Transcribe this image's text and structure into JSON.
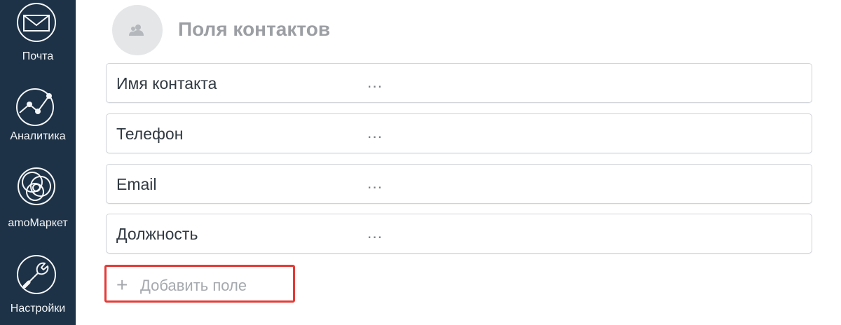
{
  "sidebar": {
    "items": [
      {
        "label": "Почта",
        "icon": "mail-icon"
      },
      {
        "label": "Аналитика",
        "icon": "analytics-icon"
      },
      {
        "label": "amoМаркет",
        "icon": "market-icon"
      },
      {
        "label": "Настройки",
        "icon": "settings-icon"
      }
    ]
  },
  "main": {
    "title": "Поля контактов",
    "fields": [
      {
        "label": "Имя контакта",
        "value": "..."
      },
      {
        "label": "Телефон",
        "value": "..."
      },
      {
        "label": "Email",
        "value": "..."
      },
      {
        "label": "Должность",
        "value": "..."
      }
    ],
    "add_field_plus": "+",
    "add_field_label": "Добавить поле"
  },
  "colors": {
    "sidebar_bg": "#1e3247",
    "highlight_border": "#e53a36",
    "title_gray": "#9b9ea3"
  }
}
